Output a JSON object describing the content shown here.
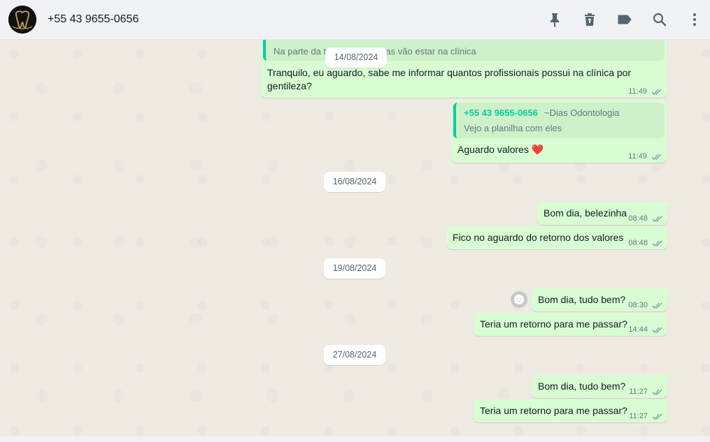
{
  "header": {
    "contact_name": "+55 43 9655-0656",
    "icons": [
      "pin-icon",
      "trash-icon",
      "label-icon",
      "search-icon",
      "menu-icon"
    ]
  },
  "colors": {
    "bubble_out": "#d9fdd3",
    "chat_bg": "#efeae2",
    "header_bg": "#f0f2f5",
    "quote_accent": "#06cf9c",
    "tick_gray": "#8696a0"
  },
  "messages": {
    "m1": {
      "quote_text": "Na parte da tarde os dentistas vão estar na clínica",
      "text_line1": "Tranquilo, eu aguardo, sabe me informar quantos profissionais possui na clínica por",
      "text_line2": "gentileza?",
      "time": "11:49"
    },
    "m2": {
      "quote_author": "+55 43 9655-0656",
      "quote_author_sub": "~Dias Odontologia",
      "quote_text": "Vejo a planilha com eles",
      "text": "Aguardo valores",
      "emoji": "❤️",
      "time": "11:49"
    },
    "m3": {
      "text": "Bom dia, belezinha",
      "time": "08:48"
    },
    "m4": {
      "text": "Fico no aguardo do retorno dos valores",
      "time": "08:48"
    },
    "m5": {
      "text": "Bom dia, tudo bem?",
      "time": "08:30"
    },
    "m6": {
      "text": "Teria um retorno para me passar?",
      "time": "14:44"
    },
    "m7": {
      "text": "Bom dia, tudo bem?",
      "time": "11:27"
    },
    "m8": {
      "text": "Teria um retorno para me passar?",
      "time": "11:27"
    }
  },
  "dates": {
    "d1": "14/08/2024",
    "d2": "16/08/2024",
    "d3": "19/08/2024",
    "d4": "27/08/2024"
  }
}
